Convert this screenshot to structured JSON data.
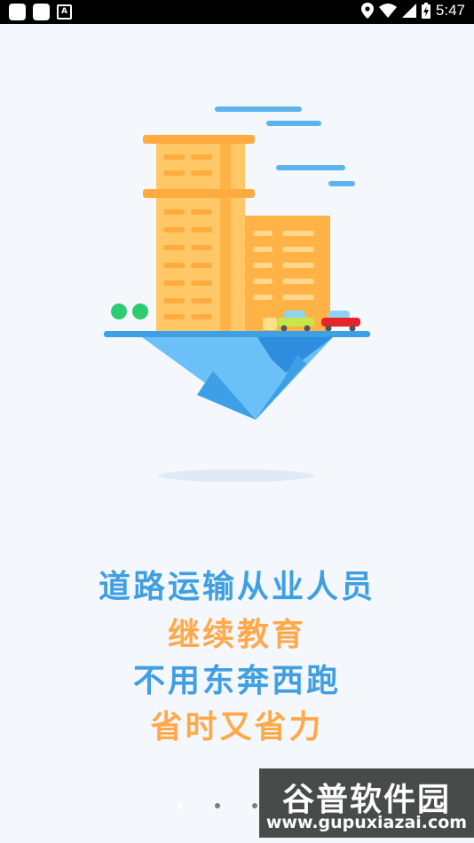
{
  "status_bar": {
    "time": "5:47",
    "notification_letter": "A"
  },
  "slogan": {
    "line1": "道路运输从业人员",
    "line2": "继续教育",
    "line3": "不用东奔西跑",
    "line4": "省时又省力"
  },
  "pager": {
    "count": 3,
    "active_index": 0
  },
  "watermark": {
    "title": "谷普软件园",
    "url": "www.gupuxiazai.com"
  },
  "colors": {
    "blue": "#3f9fe2",
    "orange": "#ffa94a",
    "background": "#f4f8fc"
  }
}
